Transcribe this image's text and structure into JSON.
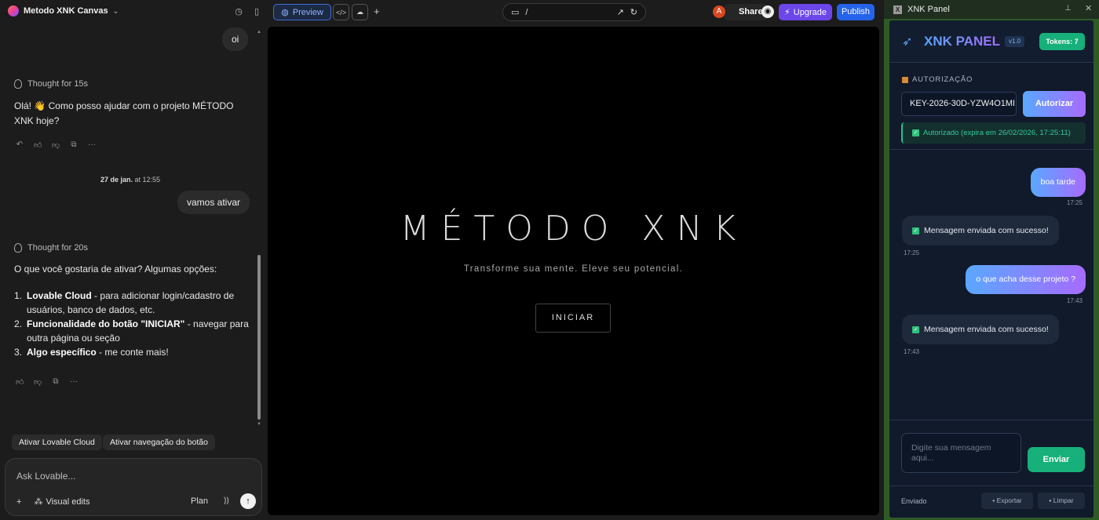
{
  "topbar": {
    "project_name": "Metodo XNK Canvas",
    "preview_label": "Preview",
    "url_path": "/",
    "avatar_initial": "A",
    "share_label": "Share",
    "upgrade_label": "Upgrade",
    "publish_label": "Publish"
  },
  "chat": {
    "user_msg_1": "oi",
    "thought_1": "Thought for 15s",
    "reply_1": "Olá! 👋 Como posso ajudar com o projeto MÉTODO XNK hoje?",
    "date_bold": "27 de jan.",
    "date_rest": "at 12:55",
    "user_msg_2": "vamos ativar",
    "thought_2": "Thought for 20s",
    "reply_2_intro": "O que você gostaria de ativar? Algumas opções:",
    "options": [
      {
        "num": "1.",
        "bold": "Lovable Cloud",
        "text": " - para adicionar login/cadastro de usuários, banco de dados, etc."
      },
      {
        "num": "2.",
        "bold": "Funcionalidade do botão \"INICIAR\"",
        "text": " - navegar para outra página ou seção"
      },
      {
        "num": "3.",
        "bold": "Algo específico",
        "text": " - me conte mais!"
      }
    ],
    "chips": [
      "Ativar Lovable Cloud",
      "Ativar navegação do botão"
    ],
    "input_placeholder": "Ask Lovable...",
    "visual_edits": "Visual edits",
    "plan_label": "Plan"
  },
  "preview": {
    "title": "MÉTODO XNK",
    "tagline": "Transforme sua mente. Eleve seu potencial.",
    "cta": "INICIAR"
  },
  "panel": {
    "window_title": "XNK Panel",
    "brand": "XNK PANEL",
    "version": "v1.0",
    "tokens": "Tokens: 7",
    "auth_label": "AUTORIZAÇÃO",
    "key_value": "KEY-2026-30D-YZW4O1MI",
    "auth_button": "Autorizar",
    "auth_status": "Autorizado (expira em 26/02/2026, 17:25:11)",
    "messages": [
      {
        "from": "user",
        "text": "boa tarde",
        "time": "17:25"
      },
      {
        "from": "bot",
        "text": "Mensagem enviada com sucesso!",
        "time": "17:25"
      },
      {
        "from": "user",
        "text": "o que acha desse projeto ?",
        "time": "17:43"
      },
      {
        "from": "bot",
        "text": "Mensagem enviada com sucesso!",
        "time": "17:43"
      }
    ],
    "message_placeholder": "Digite sua mensagem aqui...",
    "send_label": "Enviar",
    "status": "Enviado",
    "export_label": "Exportar",
    "clear_label": "Limpar"
  },
  "colors": {
    "accent_blue": "#2563eb",
    "upgrade_purple": "#6b46e8",
    "panel_green": "#17b07a"
  }
}
